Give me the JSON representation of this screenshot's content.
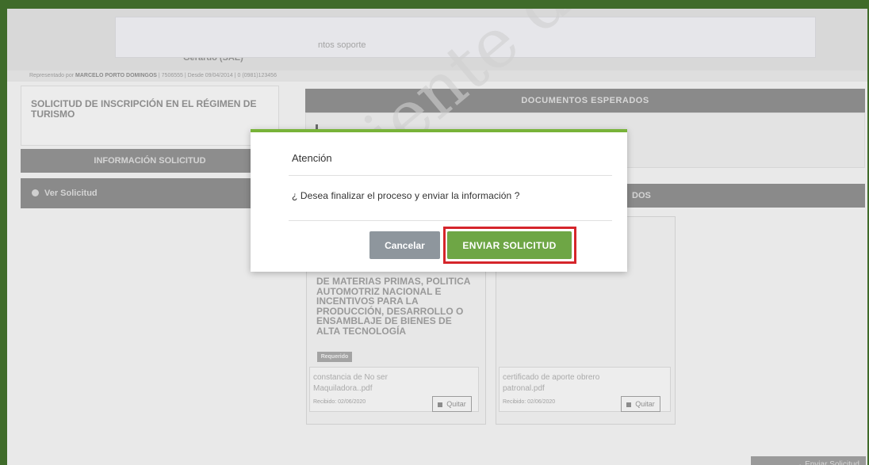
{
  "header": {
    "entity_name": "Gerardo (SAE)",
    "rep_prefix": "Representado por",
    "rep_name": "MARCELO PORTO DOMINGOS",
    "rep_details": "| 7506555 | Desde 09/04/2014 | 0 (0981)123456"
  },
  "left_panel": {
    "title": "SOLICITUD DE INSCRIPCIÓN EN EL RÉGIMEN DE TURISMO",
    "info_header": "INFORMACIÓN SOLICITUD",
    "ver_solicitud": "Ver Solicitud"
  },
  "documents": {
    "header": "DOCUMENTOS ESPERADOS",
    "sub_text": "ntos soporte",
    "received_header": "DOS",
    "card1_title": "DE MATERIAS PRIMAS, POLITICA AUTOMOTRIZ NACIONAL E INCENTIVOS PARA LA PRODUCCIÓN, DESARROLLO O ENSAMBLAJE DE BIENES DE ALTA TECNOLOGÍA",
    "required_badge": "Requerido",
    "files": [
      {
        "name": "constancia de No ser Maquiladora..pdf",
        "received": "Recibido: 02/06/2020",
        "remove_label": "Quitar"
      },
      {
        "name": "certificado de aporte obrero patronal.pdf",
        "received": "Recibido: 02/06/2020",
        "remove_label": "Quitar"
      }
    ]
  },
  "watermark": "Ambiente de Prueba",
  "footer": {
    "send_label": "→ Enviar Solicitud"
  },
  "modal": {
    "title": "Atención",
    "message": "¿ Desea finalizar el proceso y enviar la información ?",
    "cancel_label": "Cancelar",
    "confirm_label": "ENVIAR SOLICITUD"
  },
  "colors": {
    "accent_green": "#6ea645",
    "modal_top_border": "#78b339",
    "highlight_red": "#d5252b",
    "frame_green": "#3f6b2a"
  }
}
